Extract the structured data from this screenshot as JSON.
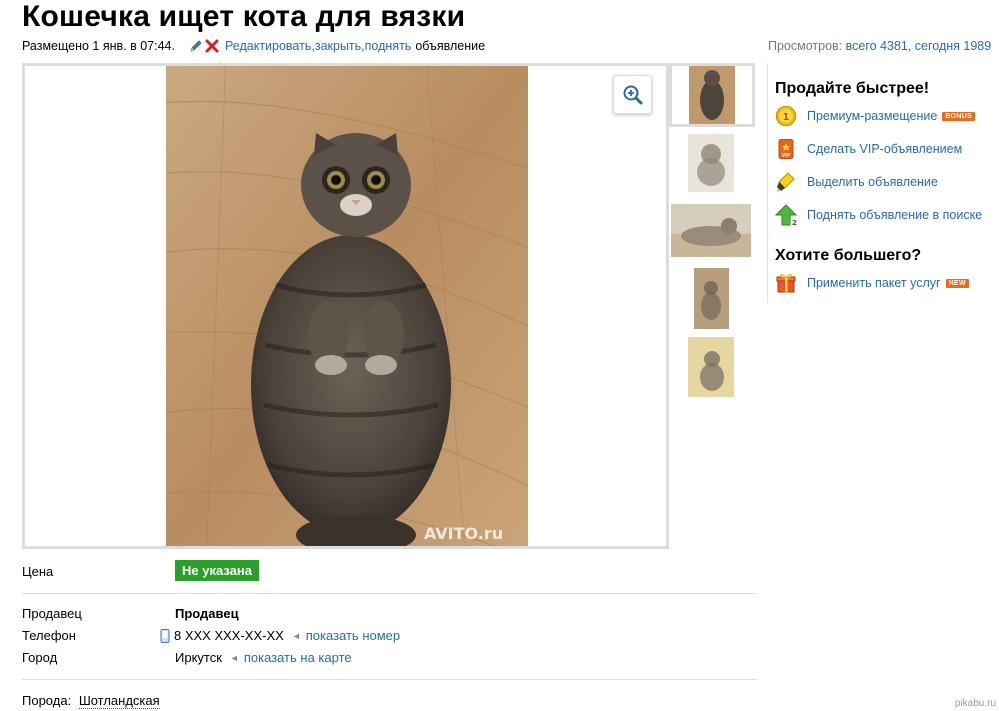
{
  "listing": {
    "title": "Кошечка ищет кота для вязки",
    "posted": "Размещено 1 янв. в 07:44.",
    "action_edit": "Редактировать",
    "action_close": "закрыть",
    "action_raise": "поднять",
    "action_tail": "объявление",
    "separator": ", ",
    "views_label": "Просмотров:",
    "views_values": "всего 4381, сегодня 1989"
  },
  "gallery": {
    "watermark": "AVITO.ru",
    "zoom_icon": "zoom-in-icon",
    "thumbnails": [
      "thumb-1",
      "thumb-2",
      "thumb-3",
      "thumb-4",
      "thumb-5"
    ]
  },
  "sidebar": {
    "heading_faster": "Продайте быстрее!",
    "services": [
      {
        "label": "Премиум-размещение",
        "badge": "BONUS",
        "icon": "coin-icon"
      },
      {
        "label": "Сделать VIP-объявлением",
        "badge": "",
        "icon": "vip-icon"
      },
      {
        "label": "Выделить объявление",
        "badge": "",
        "icon": "highlighter-icon"
      },
      {
        "label": "Поднять объявление в поиске",
        "badge": "",
        "icon": "raise-arrow-icon"
      }
    ],
    "heading_more": "Хотите большего?",
    "package": {
      "label": "Применить пакет услуг",
      "badge": "NEW",
      "icon": "gift-icon"
    }
  },
  "details": {
    "price_label": "Цена",
    "price_value": "Не указана",
    "seller_label": "Продавец",
    "seller_value": "Продавец",
    "phone_label": "Телефон",
    "phone_value": "8 XXX XXX-XX-XX",
    "phone_link": "показать номер",
    "city_label": "Город",
    "city_value": "Иркутск",
    "city_link": "показать на карте",
    "breed_label": "Порода:",
    "breed_value": "Шотландская"
  },
  "colors": {
    "link": "#2a6aa8",
    "price_green": "#2aa02a",
    "badge_orange": "#e86b1c",
    "border_gray": "#dcdcdc"
  },
  "footer": {
    "watermark": "pikabu.ru"
  }
}
